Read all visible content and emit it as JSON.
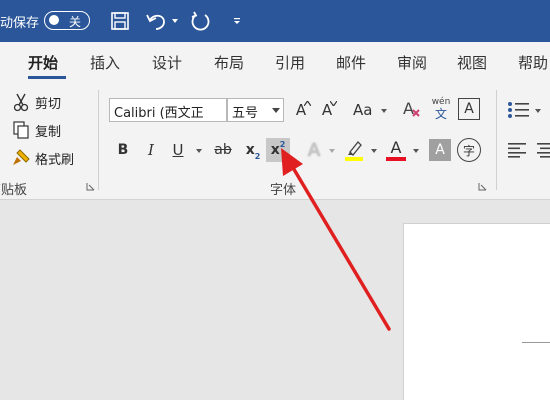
{
  "titlebar": {
    "autosave_label": "动保存",
    "autosave_state": "关",
    "qat_icons": [
      "save-icon",
      "undo-icon",
      "redo-icon",
      "customize-qat-icon"
    ]
  },
  "tabs": [
    {
      "label": "开始",
      "active": true
    },
    {
      "label": "插入"
    },
    {
      "label": "设计"
    },
    {
      "label": "布局"
    },
    {
      "label": "引用"
    },
    {
      "label": "邮件"
    },
    {
      "label": "审阅"
    },
    {
      "label": "视图"
    },
    {
      "label": "帮助"
    }
  ],
  "clipboard": {
    "cut": "剪切",
    "copy": "复制",
    "format_painter": "格式刷",
    "group_label": "剪贴板"
  },
  "font": {
    "font_name": "Calibri (西文正",
    "font_size": "五号",
    "group_label": "字体",
    "change_case": "Aa",
    "phonetic_top": "wén",
    "phonetic_bottom": "文",
    "char_border": "A",
    "enclose_char": "字",
    "bold": "B",
    "italic": "I",
    "underline": "U",
    "strike": "ab",
    "subscript_base": "x",
    "subscript_mark": "2",
    "superscript_base": "x",
    "superscript_mark": "2",
    "text_effects": "A",
    "font_color": "A",
    "char_shading": "A",
    "grow": "A",
    "shrink": "A"
  },
  "colors": {
    "title_bar": "#2b579a",
    "highlight": "#ffff00",
    "font_color": "#e81123",
    "arrow": "#e02020"
  }
}
